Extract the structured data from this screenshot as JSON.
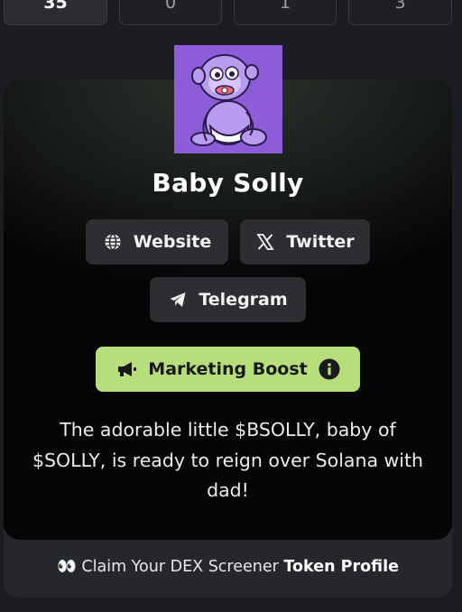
{
  "stats": [
    {
      "value": "35",
      "active": true
    },
    {
      "value": "0",
      "active": false
    },
    {
      "value": "1",
      "active": false
    },
    {
      "value": "3",
      "active": false
    }
  ],
  "token": {
    "name": "Baby Solly",
    "description": "The adorable little $BSOLLY, baby of $SOLLY, is ready to reign over Solana with dad!"
  },
  "links": {
    "website_label": "Website",
    "twitter_label": "Twitter",
    "telegram_label": "Telegram"
  },
  "boost": {
    "label": "Marketing Boost",
    "color": "#b6df7b"
  },
  "claim": {
    "emoji": "👀",
    "prefix": "Claim Your DEX Screener",
    "bold": "Token Profile"
  },
  "colors": {
    "background": "#1c1d22",
    "token_image_bg": "#8c5cd9",
    "link_button_bg": "#2c2e31"
  },
  "icons": [
    "globe-icon",
    "x-icon",
    "telegram-icon",
    "megaphone-icon",
    "info-icon",
    "eyes-emoji"
  ]
}
